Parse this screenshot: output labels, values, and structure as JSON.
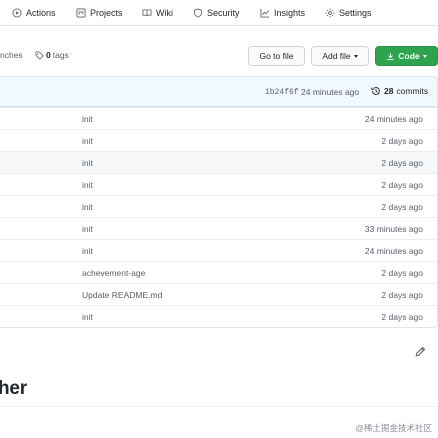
{
  "nav": {
    "tabs": [
      {
        "label": "Actions",
        "icon": "play-circle-icon"
      },
      {
        "label": "Projects",
        "icon": "project-board-icon"
      },
      {
        "label": "Wiki",
        "icon": "book-icon"
      },
      {
        "label": "Security",
        "icon": "shield-icon"
      },
      {
        "label": "Insights",
        "icon": "graph-icon"
      },
      {
        "label": "Settings",
        "icon": "gear-icon"
      }
    ]
  },
  "toolbar": {
    "branches_label": "nches",
    "tags_count": "0",
    "tags_label": "tags",
    "go_to_file": "Go to file",
    "add_file": "Add file",
    "code": "Code"
  },
  "commit": {
    "sha": "1b24f6f",
    "time": "24 minutes ago",
    "count": "28",
    "count_label": "commits"
  },
  "files": [
    {
      "message": "init",
      "age": "24 minutes ago"
    },
    {
      "message": "init",
      "age": "2 days ago"
    },
    {
      "message": "init",
      "age": "2 days ago"
    },
    {
      "message": "init",
      "age": "2 days ago"
    },
    {
      "message": "init",
      "age": "2 days ago"
    },
    {
      "message": "init",
      "age": "33 minutes ago"
    },
    {
      "message": "init",
      "age": "24 minutes ago"
    },
    {
      "message": "achevement-age",
      "age": "2 days ago"
    },
    {
      "message": "Update README.md",
      "age": "2 days ago"
    },
    {
      "message": "init",
      "age": "2 days ago"
    }
  ],
  "readme": {
    "title_fragment": "her"
  },
  "watermark": "@稀土掘金技术社区",
  "colors": {
    "code_button": "#2ea44f",
    "commit_header_bg": "#f1f8ff",
    "border": "#e1e4e8"
  }
}
